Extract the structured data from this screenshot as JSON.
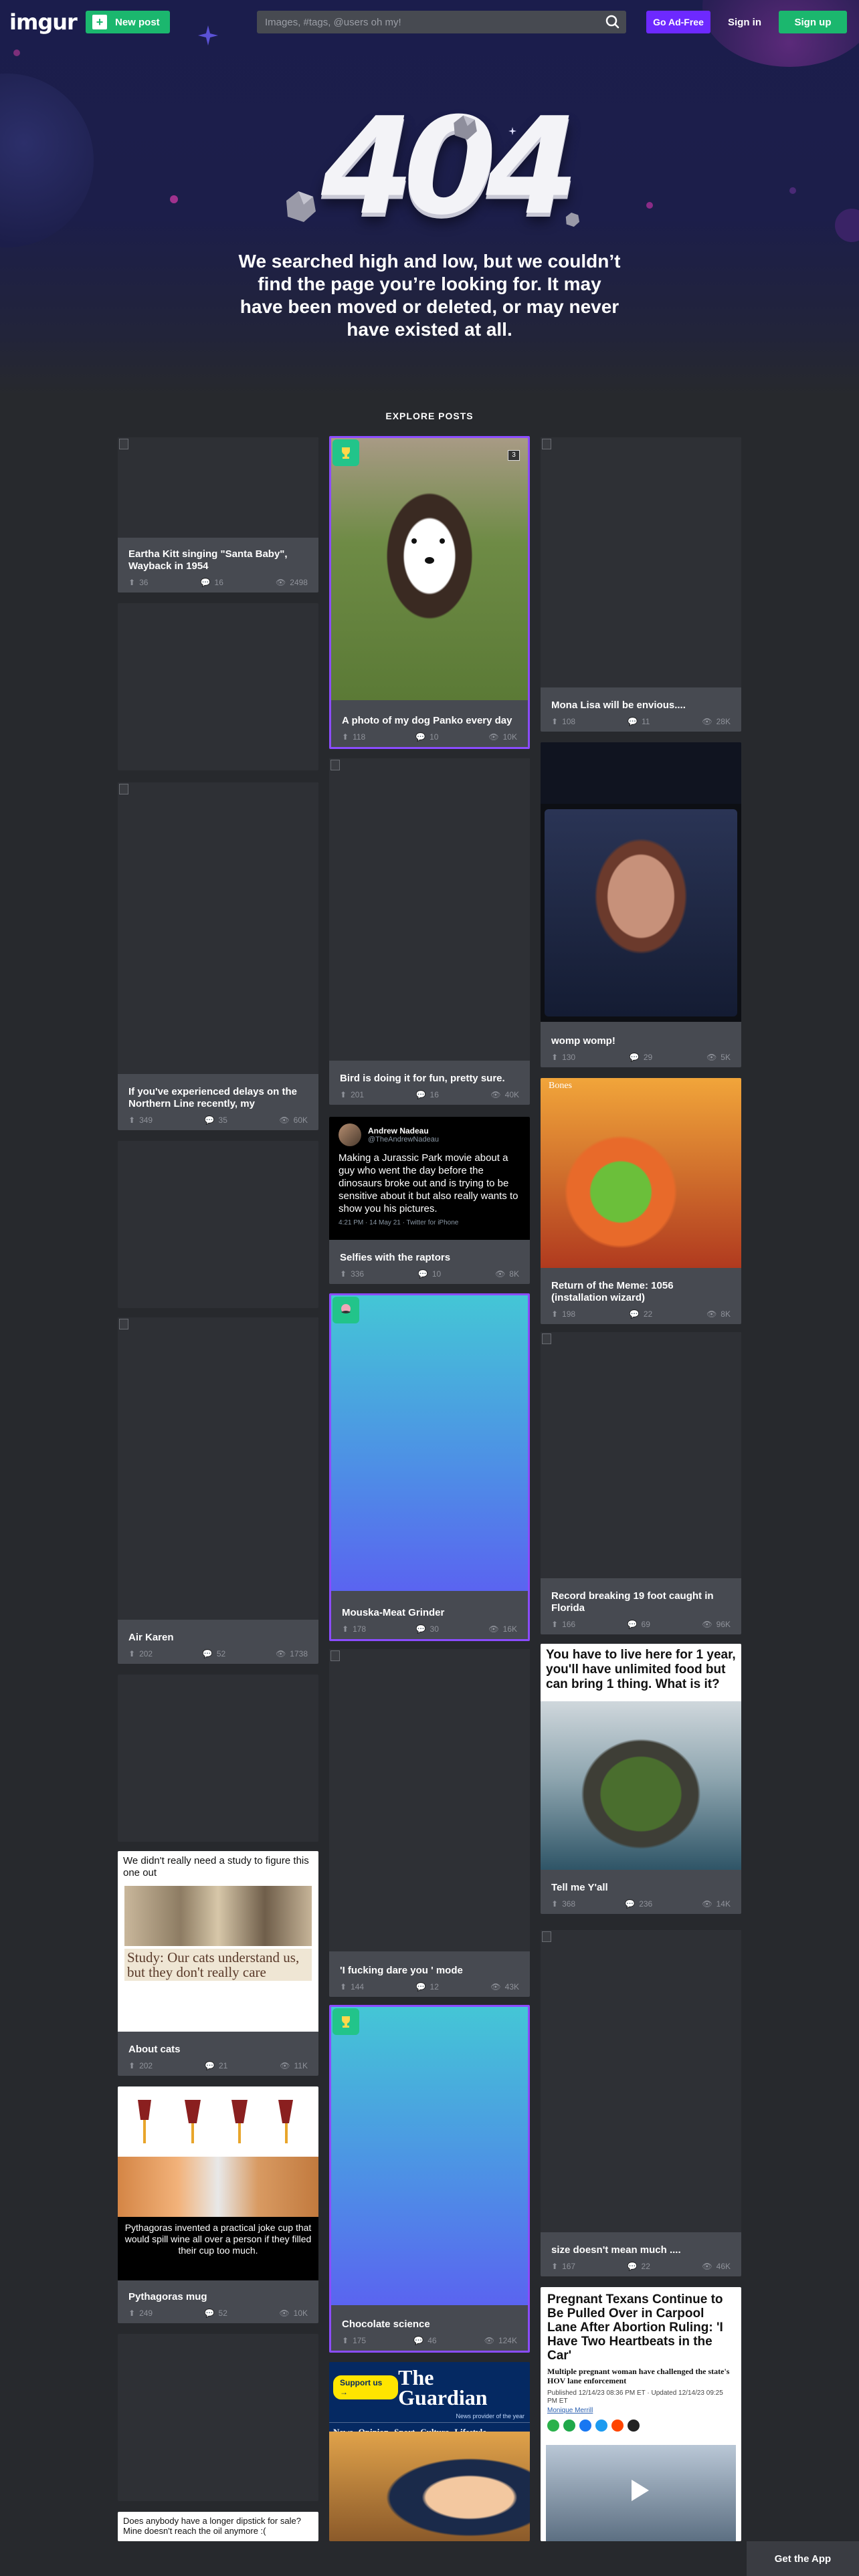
{
  "header": {
    "logo": "imgur",
    "new_post": "New post",
    "search_placeholder": "Images, #tags, @users oh my!",
    "go_ad_free": "Go Ad-Free",
    "sign_in": "Sign in",
    "sign_up": "Sign up"
  },
  "error": {
    "code": "404",
    "message": "We searched high and low, but we couldn’t find the page you’re looking for. It may have been moved or deleted, or may never have existed at all."
  },
  "explore": {
    "heading": "EXPLORE POSTS"
  },
  "posts": [
    {
      "title": "Eartha Kitt singing \"Santa Baby\", Wayback in 1954",
      "ups": "36",
      "comments": "16",
      "views": "2498"
    },
    {
      "title": "",
      "ups": "",
      "comments": "",
      "views": ""
    },
    {
      "title": "If you've experienced delays on the Northern Line recently, my apologies...",
      "ups": "349",
      "comments": "35",
      "views": "60K"
    },
    {
      "title": "",
      "ups": "",
      "comments": "",
      "views": ""
    },
    {
      "title": "Air Karen",
      "ups": "202",
      "comments": "52",
      "views": "1738"
    },
    {
      "title": "",
      "ups": "",
      "comments": "",
      "views": ""
    },
    {
      "title": "About cats",
      "ups": "202",
      "comments": "21",
      "views": "11K",
      "overlay": "We didn't really need a study to figure this one out",
      "headline": "Study: Our cats understand us, but they don't really care"
    },
    {
      "title": "Pythagoras mug",
      "ups": "249",
      "comments": "52",
      "views": "10K",
      "caption": "Pythagoras invented a practical joke cup that would spill wine all over a person if they filled their cup too much."
    },
    {
      "title": "",
      "ups": "",
      "comments": "",
      "views": ""
    },
    {
      "title": "",
      "ups": "",
      "comments": "",
      "views": "",
      "overlay": "Does anybody have a longer dipstick for sale? Mine doesn't reach the oil anymore :("
    },
    {
      "title": "A photo of my dog Panko every day",
      "ups": "118",
      "comments": "10",
      "views": "10K"
    },
    {
      "title": "Bird is doing it for fun, pretty sure.",
      "ups": "201",
      "comments": "16",
      "views": "40K"
    },
    {
      "title": "Selfies with the raptors",
      "ups": "336",
      "comments": "10",
      "views": "8K",
      "tweet_name": "Andrew Nadeau",
      "tweet_handle": "@TheAndrewNadeau",
      "tweet_text": "Making a Jurassic Park movie about a guy who went the day before the dinosaurs broke out and is trying to be sensitive about it but also really wants to show you his pictures.",
      "tweet_meta": "4:21 PM · 14 May 21 · Twitter for iPhone"
    },
    {
      "title": "Mouska-Meat Grinder",
      "ups": "178",
      "comments": "30",
      "views": "16K"
    },
    {
      "title": "'I fucking dare you ' mode",
      "ups": "144",
      "comments": "12",
      "views": "43K"
    },
    {
      "title": "Chocolate science",
      "ups": "175",
      "comments": "46",
      "views": "124K"
    },
    {
      "title": "",
      "ups": "",
      "comments": "",
      "views": "",
      "support": "Support us →",
      "paper": "The Guardian",
      "tagline": "News provider of the year",
      "nav": [
        "News",
        "Opinion",
        "Sport",
        "Culture",
        "Lifestyle"
      ]
    },
    {
      "title": "Mona Lisa will be envious....",
      "ups": "108",
      "comments": "11",
      "views": "28K"
    },
    {
      "title": "womp womp!",
      "ups": "130",
      "comments": "29",
      "views": "5K"
    },
    {
      "title": "Return of the Meme: 1056 (installation wizard)",
      "ups": "198",
      "comments": "22",
      "views": "8K",
      "label": "Bones"
    },
    {
      "title": "Record breaking 19 foot caught in Florida",
      "ups": "166",
      "comments": "69",
      "views": "96K"
    },
    {
      "title": "Tell me Y'all",
      "ups": "368",
      "comments": "236",
      "views": "14K",
      "overlay": "You have to live here for 1 year, you'll have unlimited food but can bring 1 thing. What is it?"
    },
    {
      "title": "size doesn't mean much ....",
      "ups": "167",
      "comments": "22",
      "views": "46K"
    },
    {
      "title": "",
      "ups": "",
      "comments": "",
      "views": "",
      "headline": "Pregnant Texans Continue to Be Pulled Over in Carpool Lane After Abortion Ruling: 'I Have Two Heartbeats in the Car'",
      "subhead": "Multiple pregnant woman have challenged the state's HOV lane enforcement",
      "meta": "Published 12/14/23 08:36 PM ET · Updated 12/14/23 09:25 PM ET",
      "author": "Monique Merrill"
    }
  ],
  "footer": {
    "get_app": "Get the App"
  }
}
